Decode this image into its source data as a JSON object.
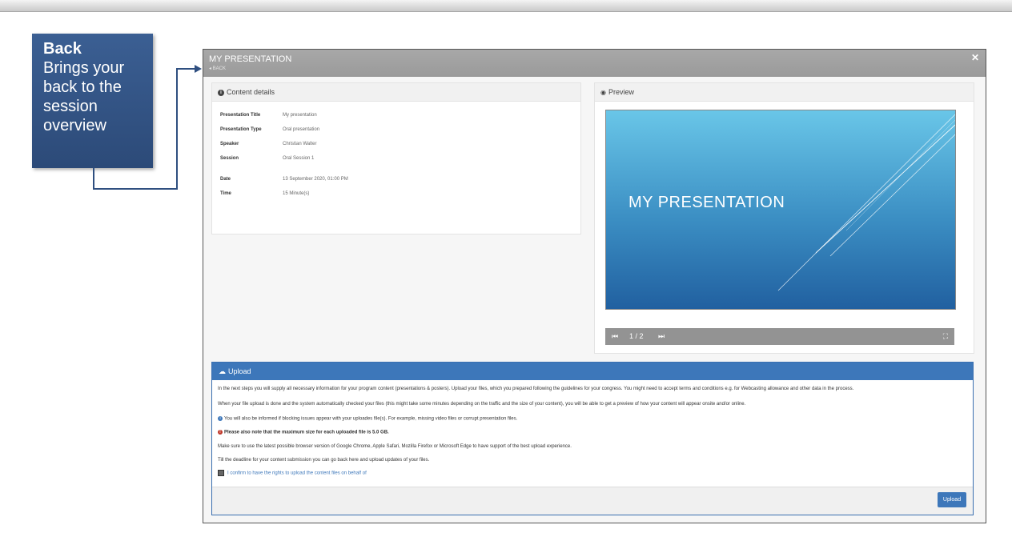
{
  "callout": {
    "title": "Back",
    "line1": "Brings your",
    "line2": "back to the",
    "line3": "session",
    "line4": "overview"
  },
  "modal": {
    "title": "MY PRESENTATION",
    "back_label": "◂ BACK",
    "close_icon": "close-icon"
  },
  "content_details": {
    "heading": "Content details",
    "rows": [
      {
        "label": "Presentation Title",
        "value": "My presentation"
      },
      {
        "label": "Presentation Type",
        "value": "Oral presentation"
      },
      {
        "label": "Speaker",
        "value": "Christian Walter"
      },
      {
        "label": "Session",
        "value": "Oral Session 1"
      },
      {
        "label": "Date",
        "value": "13 September 2020, 01:00 PM"
      },
      {
        "label": "Time",
        "value": "15 Minute(s)"
      }
    ]
  },
  "preview": {
    "heading": "Preview",
    "slide_title": "MY PRESENTATION",
    "page_indicator": "1 / 2"
  },
  "upload": {
    "heading": "Upload",
    "p1": "In the next steps you will supply all necessary information for your program content (presentations & posters). Upload your files, which you prepared following the guidelines for your congress. You might need to accept terms and conditions e.g. for Webcasting allowance and other data in the process.",
    "p2": "When your file upload is done and the system automatically checked your files (this might take some minutes depending on the traffic and the size of your content), you will be able to get a preview of how your content will appear onsite and/or online.",
    "p3": "You will also be informed if blocking issues appear with your uploades file(s). For example, missing video files or corrupt presentation files.",
    "p4": "Please also note that the maximum size for each uploaded file is 5.0 GB.",
    "p5": "Make sure to use the latest possible browser version of Google Chrome, Apple Safari, Mozilla Firefox or Microsoft Edge to have support of the best upload experience.",
    "p6": "Till the deadline for your content submission you can go back here and upload updates of your files.",
    "consent": "I confirm to have the rights to upload the content files on behalf of",
    "button": "Upload"
  },
  "colors": {
    "callout": "#2f4f80",
    "header_gray": "#9e9e9e",
    "upload_blue": "#3d77ba",
    "slide_top": "#69c6e8",
    "slide_bottom": "#2160a0"
  }
}
